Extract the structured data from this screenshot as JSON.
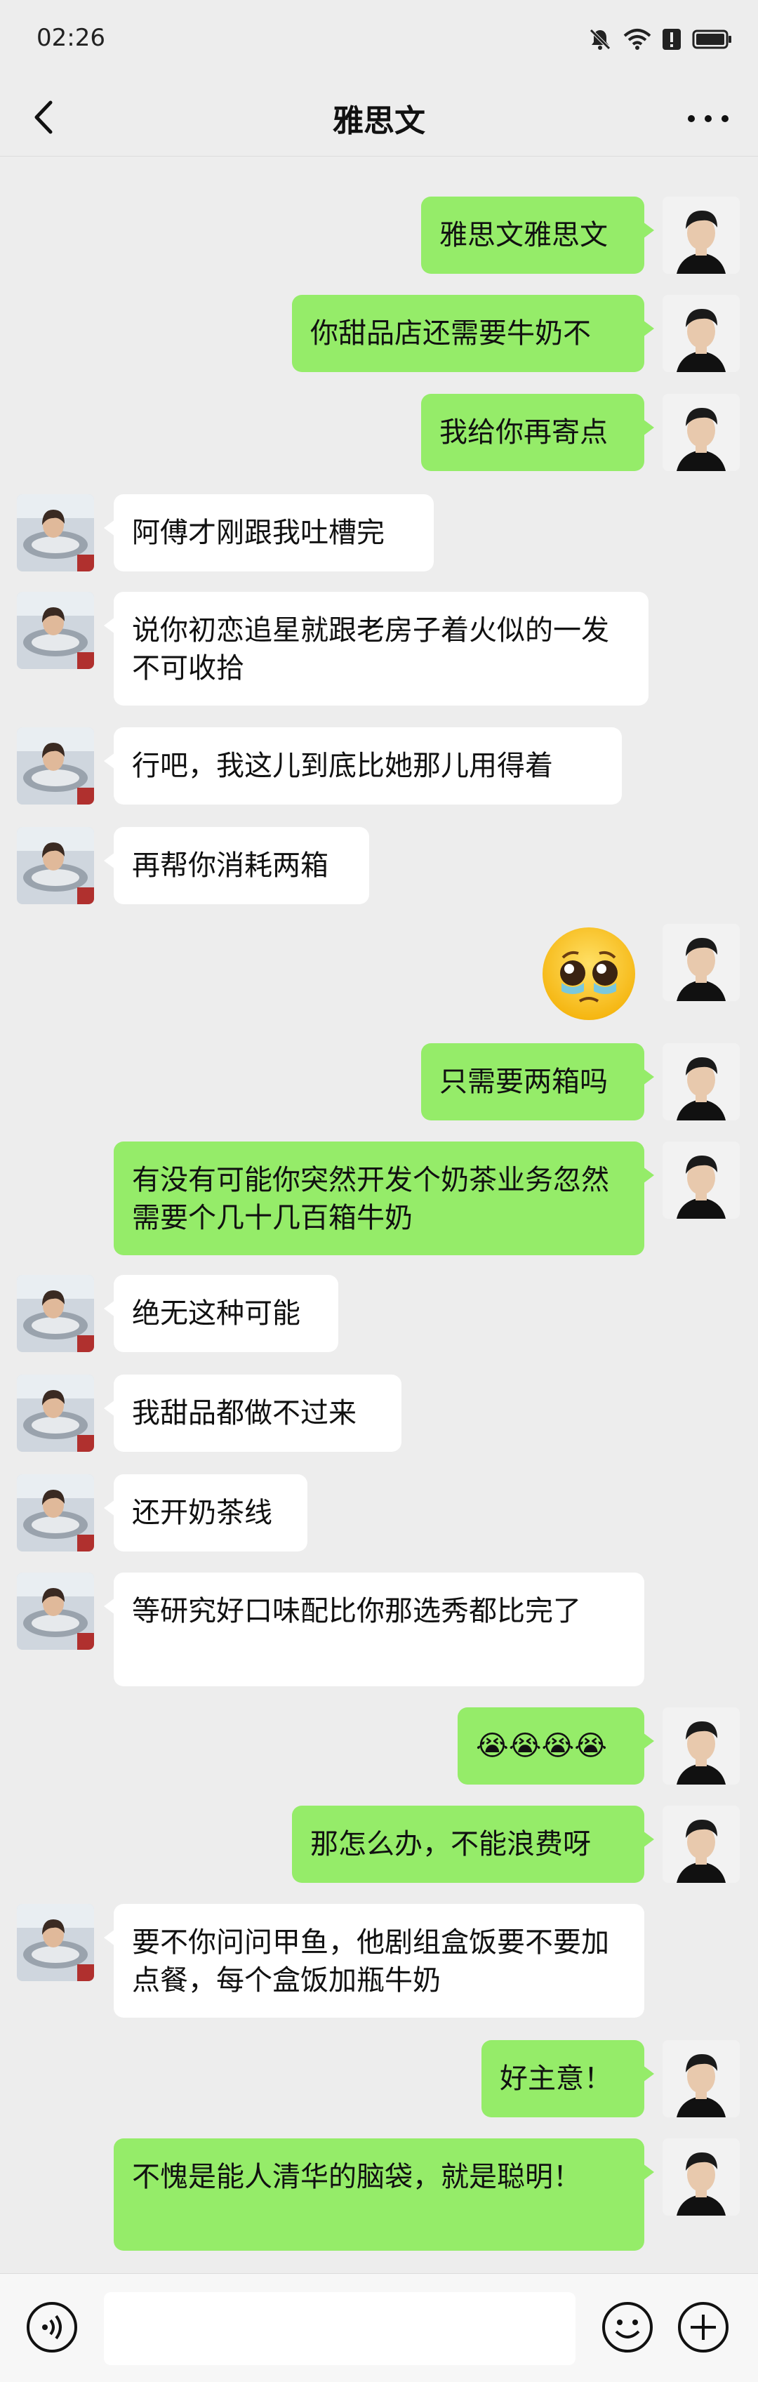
{
  "status_bar": {
    "time": "02:26"
  },
  "header": {
    "title": "雅思文"
  },
  "messages": [
    {
      "side": "me",
      "text": "雅思文雅思文"
    },
    {
      "side": "me",
      "text": "你甜品店还需要牛奶不"
    },
    {
      "side": "me",
      "text": "我给你再寄点"
    },
    {
      "side": "other",
      "text": "阿傅才刚跟我吐槽完"
    },
    {
      "side": "other",
      "text": "说你初恋追星就跟老房子着火似的一发不可收拾"
    },
    {
      "side": "other",
      "text": "行吧，我这儿到底比她那儿用得着"
    },
    {
      "side": "other",
      "text": "再帮你消耗两箱"
    },
    {
      "side": "me",
      "sticker": "pleading-face-icon"
    },
    {
      "side": "me",
      "text": "只需要两箱吗"
    },
    {
      "side": "me",
      "text": "有没有可能你突然开发个奶茶业务忽然需要个几十几百箱牛奶"
    },
    {
      "side": "other",
      "text": "绝无这种可能"
    },
    {
      "side": "other",
      "text": "我甜品都做不过来"
    },
    {
      "side": "other",
      "text": "还开奶茶线"
    },
    {
      "side": "other",
      "text": "等研究好口味配比你那选秀都比完了"
    },
    {
      "side": "me",
      "text": "😭😭😭😭"
    },
    {
      "side": "me",
      "text": "那怎么办，不能浪费呀"
    },
    {
      "side": "other",
      "text": "要不你问问甲鱼，他剧组盒饭要不要加点餐，每个盒饭加瓶牛奶"
    },
    {
      "side": "me",
      "text": "好主意！"
    },
    {
      "side": "me",
      "text": "不愧是能人清华的脑袋，就是聪明！"
    }
  ],
  "input_bar": {
    "placeholder": ""
  },
  "colors": {
    "me_bubble": "#95ec69",
    "other_bubble": "#ffffff",
    "background": "#ededed"
  }
}
